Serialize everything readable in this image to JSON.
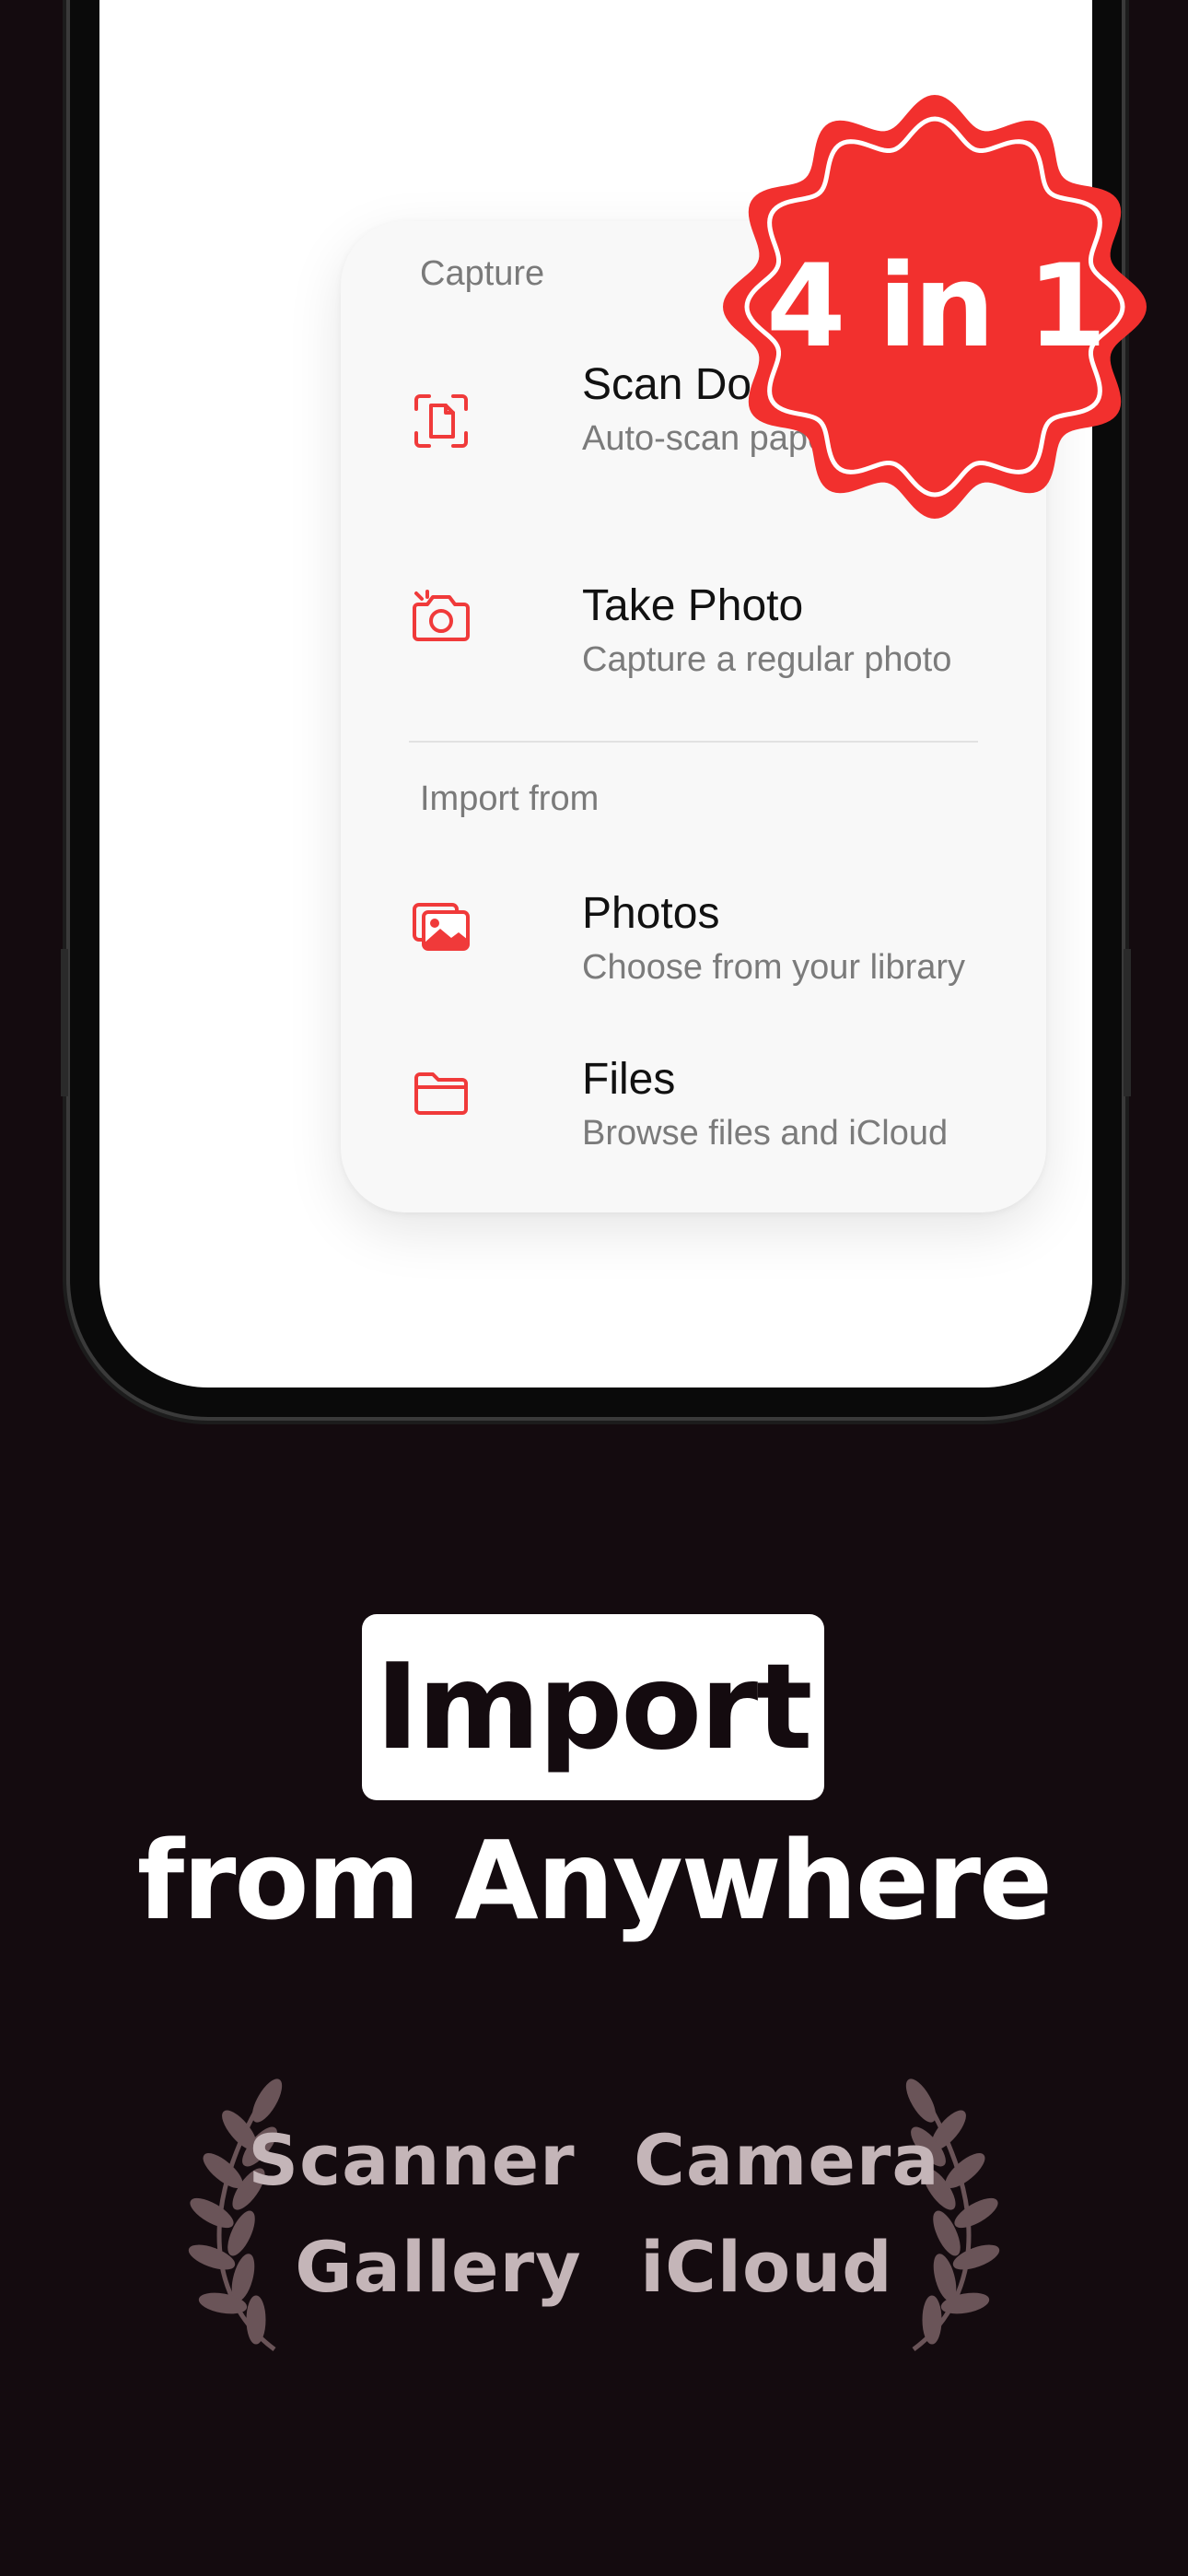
{
  "menu": {
    "capture_label": "Capture",
    "import_label": "Import from",
    "items": [
      {
        "title": "Scan Document",
        "subtitle": "Auto-scan paper and notes",
        "icon": "scan-document-icon"
      },
      {
        "title": "Take Photo",
        "subtitle": "Capture a regular photo",
        "icon": "camera-icon"
      },
      {
        "title": "Photos",
        "subtitle": "Choose from your library",
        "icon": "photos-icon"
      },
      {
        "title": "Files",
        "subtitle": "Browse files and iCloud",
        "icon": "folder-icon"
      }
    ]
  },
  "badge": {
    "text": "4 in 1",
    "color": "#f2302e"
  },
  "headline": {
    "highlight": "Import",
    "rest": "from Anywhere"
  },
  "features": {
    "row1": [
      "Scanner",
      "Camera"
    ],
    "row2": [
      "Gallery",
      "iCloud"
    ]
  },
  "colors": {
    "background": "#140b0f",
    "accent": "#f03a3a",
    "feature_text": "#c4b5b8"
  }
}
